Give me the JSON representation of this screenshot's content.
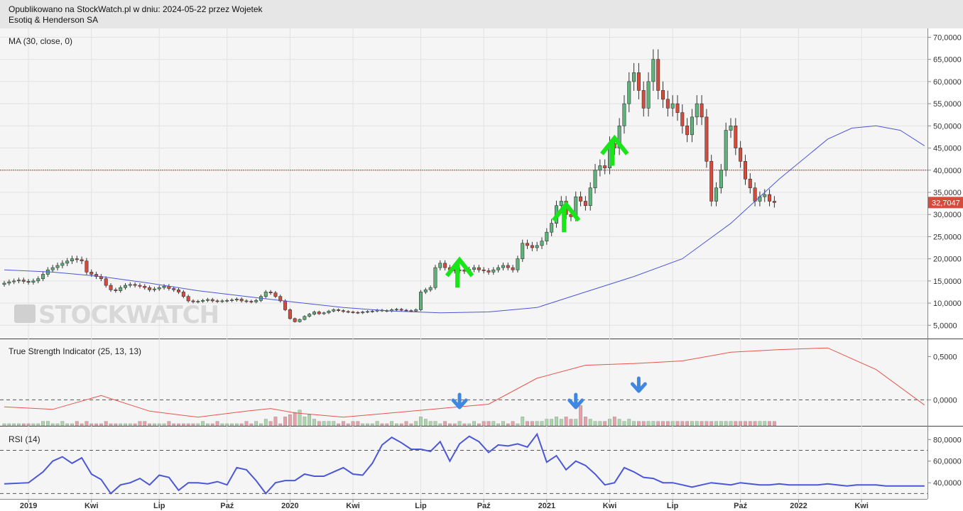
{
  "header": {
    "published": "Opublikowano na StockWatch.pl w dniu: 2024-05-22 przez Wojetek",
    "company": "Esotiq & Henderson SA"
  },
  "watermark": "STOCKWATCH",
  "colors": {
    "up": "#5fb37a",
    "down": "#d64b3c",
    "ma": "#4b57d6",
    "tsi": "#e8544a",
    "rsi": "#4b57d6",
    "arrow_up": "#19e619",
    "arrow_down": "#3f87e0",
    "price_tag": "#d64b3c",
    "ref_line": "#c0392b"
  },
  "chart_data": [
    {
      "type": "candlestick",
      "title": "MA (30, close, 0)",
      "ylim": [
        2000,
        72000
      ],
      "yticks": [
        "5,0000",
        "10,0000",
        "15,0000",
        "20,0000",
        "25,0000",
        "30,0000",
        "35,0000",
        "40,0000",
        "45,0000",
        "50,0000",
        "55,0000",
        "60,0000",
        "65,0000",
        "70,0000"
      ],
      "ytick_values": [
        5000,
        10000,
        15000,
        20000,
        25000,
        30000,
        35000,
        40000,
        45000,
        50000,
        55000,
        60000,
        65000,
        70000
      ],
      "xticks": [
        "2019",
        "Kwi",
        "Lip",
        "Paź",
        "2020",
        "Kwi",
        "Lip",
        "Paź",
        "2021",
        "Kwi",
        "Lip",
        "Paź",
        "2022",
        "Kwi"
      ],
      "xtick_index": [
        5,
        18,
        32,
        46,
        59,
        72,
        86,
        99,
        112,
        125,
        138,
        152,
        164,
        177
      ],
      "last_price": "32,7047",
      "reference_level": 40000,
      "close": [
        14500,
        14800,
        15000,
        15200,
        14900,
        14700,
        15000,
        15500,
        16500,
        17500,
        18000,
        18500,
        19000,
        19500,
        20000,
        19800,
        19500,
        17000,
        16500,
        16000,
        15500,
        14000,
        13000,
        12800,
        13500,
        14000,
        14200,
        14000,
        13800,
        13500,
        13000,
        13200,
        13500,
        13800,
        13300,
        13000,
        12500,
        11500,
        10500,
        10300,
        10400,
        10600,
        10800,
        10500,
        10400,
        10500,
        10600,
        10700,
        10900,
        10500,
        10400,
        10300,
        10600,
        11500,
        12500,
        12300,
        11500,
        10500,
        8500,
        6500,
        5800,
        6300,
        7000,
        7500,
        8000,
        7600,
        7800,
        8200,
        8500,
        8300,
        8100,
        8000,
        7900,
        7800,
        8000,
        8100,
        8200,
        8400,
        8300,
        8200,
        8500,
        8600,
        8400,
        8300,
        8200,
        8500,
        12500,
        13000,
        13500,
        18000,
        19000,
        18000,
        17500,
        17300,
        17500,
        17200,
        17600,
        18000,
        17500,
        17300,
        17000,
        17500,
        18000,
        18500,
        18000,
        17500,
        20000,
        23500,
        23000,
        22500,
        23000,
        24000,
        26000,
        28000,
        32000,
        33000,
        30000,
        29500,
        34000,
        33000,
        32000,
        36000,
        40000,
        41000,
        40500,
        46000,
        45000,
        50000,
        55000,
        60000,
        62000,
        58000,
        54000,
        60000,
        65000,
        58000,
        56000,
        54000,
        55000,
        53000,
        50000,
        48000,
        52000,
        55000,
        52000,
        42000,
        33000,
        36000,
        40000,
        49000,
        50000,
        45000,
        42000,
        38000,
        36000,
        33000,
        34000,
        34500,
        33000,
        32700
      ],
      "ma30_x": [
        0,
        10,
        20,
        30,
        40,
        50,
        60,
        70,
        80,
        90,
        100,
        110,
        120,
        130,
        140,
        150,
        160,
        170,
        175,
        180,
        185,
        190
      ],
      "ma30": [
        17500,
        17000,
        16000,
        14500,
        12800,
        11500,
        10200,
        9000,
        8200,
        7800,
        8000,
        9000,
        12500,
        16000,
        20000,
        28000,
        38000,
        47000,
        49500,
        50000,
        49000,
        45500
      ],
      "annotations": [
        {
          "symbol": "up-arrow",
          "index": 94
        },
        {
          "symbol": "up-arrow",
          "index": 116
        },
        {
          "symbol": "up-arrow",
          "index": 126
        }
      ]
    },
    {
      "type": "line",
      "title": "True Strength Indicator (25, 13, 13)",
      "ylim": [
        -0.3,
        0.7
      ],
      "yticks": [
        "0,0000",
        "0,5000"
      ],
      "ytick_values": [
        0,
        0.5
      ],
      "zero_line": 0,
      "x": [
        0,
        10,
        20,
        30,
        40,
        50,
        55,
        60,
        70,
        80,
        90,
        100,
        110,
        120,
        130,
        140,
        150,
        160,
        170,
        180,
        190
      ],
      "values": [
        -0.08,
        -0.11,
        0.05,
        -0.13,
        -0.2,
        -0.13,
        -0.1,
        -0.15,
        -0.2,
        -0.15,
        -0.1,
        -0.05,
        0.25,
        0.4,
        0.42,
        0.45,
        0.55,
        0.58,
        0.6,
        0.35,
        -0.06
      ],
      "volume": [
        0,
        0,
        0,
        0,
        0,
        0,
        0,
        0,
        1,
        1,
        0,
        0,
        1,
        0,
        0,
        1,
        0,
        1,
        0,
        0,
        0,
        1,
        0,
        0,
        0,
        0,
        0,
        0,
        1,
        1,
        0,
        0,
        0,
        0,
        1,
        0,
        0,
        0,
        0,
        0,
        0,
        1,
        0,
        0,
        1,
        0,
        0,
        0,
        0,
        0,
        1,
        0,
        1,
        0,
        2,
        1,
        3,
        0,
        3,
        4,
        5,
        6,
        3,
        4,
        2,
        1,
        1,
        1,
        1,
        0,
        1,
        0,
        1,
        1,
        0,
        0,
        0,
        1,
        0,
        0,
        1,
        0,
        0,
        1,
        0,
        1,
        3,
        2,
        1,
        1,
        0,
        1,
        0,
        0,
        1,
        0,
        0,
        1,
        0,
        1,
        1,
        1,
        0,
        1,
        0,
        1,
        0,
        3,
        1,
        1,
        1,
        1,
        2,
        2,
        3,
        2,
        3,
        2,
        2,
        8,
        3,
        2,
        1,
        1,
        1,
        2,
        3,
        2,
        1,
        2,
        1,
        1,
        1,
        1,
        1,
        1,
        1,
        1,
        1,
        1,
        1,
        1,
        1,
        1,
        1,
        1,
        1,
        1,
        1,
        1,
        1,
        1,
        1,
        1,
        1,
        1,
        1,
        1,
        1,
        1,
        1,
        1,
        1,
        1,
        1,
        1,
        1,
        1,
        1,
        1,
        1,
        1,
        1,
        1,
        1,
        1
      ],
      "annotations": [
        {
          "symbol": "down-arrow",
          "index": 94
        },
        {
          "symbol": "down-arrow",
          "index": 118
        },
        {
          "symbol": "down-arrow",
          "index": 131
        }
      ]
    },
    {
      "type": "line",
      "title": "RSI (14)",
      "ylim": [
        25,
        92
      ],
      "yticks": [
        "40,0000",
        "60,0000",
        "80,0000"
      ],
      "ytick_values": [
        40,
        60,
        80
      ],
      "levels": [
        30,
        70
      ],
      "x": [
        0,
        5,
        8,
        10,
        12,
        14,
        16,
        18,
        20,
        22,
        24,
        26,
        28,
        30,
        32,
        34,
        36,
        38,
        40,
        42,
        44,
        46,
        48,
        50,
        52,
        54,
        56,
        58,
        60,
        62,
        64,
        66,
        68,
        70,
        72,
        74,
        76,
        78,
        80,
        82,
        84,
        86,
        88,
        90,
        92,
        94,
        96,
        98,
        100,
        102,
        104,
        106,
        108,
        110,
        112,
        114,
        116,
        118,
        120,
        122,
        124,
        126,
        128,
        130,
        132,
        134,
        136,
        138,
        140,
        142,
        144,
        146,
        148,
        150,
        152,
        154,
        156,
        158,
        160,
        162,
        164,
        166,
        168,
        170,
        172,
        174,
        176,
        178,
        180,
        182,
        184,
        186,
        188,
        190
      ],
      "values": [
        39,
        40,
        50,
        60,
        64,
        58,
        63,
        48,
        43,
        30,
        38,
        40,
        44,
        38,
        47,
        45,
        33,
        40,
        40,
        39,
        41,
        38,
        54,
        52,
        42,
        30,
        40,
        42,
        42,
        48,
        46,
        46,
        50,
        54,
        48,
        47,
        58,
        75,
        82,
        77,
        71,
        71,
        69,
        78,
        60,
        76,
        83,
        78,
        68,
        75,
        74,
        76,
        73,
        85,
        59,
        65,
        52,
        60,
        56,
        48,
        38,
        40,
        54,
        50,
        45,
        44,
        40,
        40,
        38,
        36,
        38,
        40,
        39,
        38,
        40,
        39,
        38,
        38,
        39,
        38,
        38,
        38,
        38,
        39,
        38,
        37,
        38,
        38,
        38,
        37,
        37,
        37,
        37,
        37
      ]
    }
  ]
}
